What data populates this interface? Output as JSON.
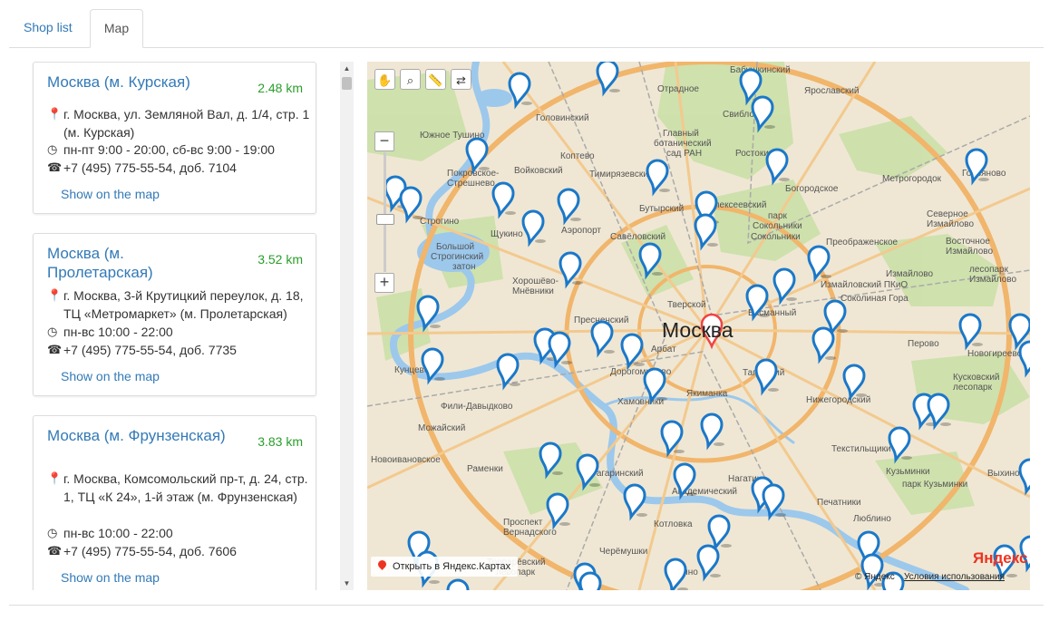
{
  "tabs": {
    "shop_list": "Shop list",
    "map": "Map"
  },
  "shops": [
    {
      "title": "Москва (м. Курская)",
      "distance": "2.48 km",
      "address": "г. Москва, ул. Земляной Вал, д. 1/4, стр. 1 (м. Курская)",
      "hours": "пн-пт 9:00 - 20:00, сб-вс 9:00 - 19:00",
      "phone": "+7 (495) 775-55-54, доб. 7104",
      "link": "Show on the map"
    },
    {
      "title": "Москва (м. Пролетарская)",
      "distance": "3.52 km",
      "address": "г. Москва, 3-й Крутицкий переулок, д. 18, ТЦ «Метромаркет» (м. Пролетарская)",
      "hours": "пн-вс 10:00 - 22:00",
      "phone": "+7 (495) 775-55-54, доб. 7735",
      "link": "Show on the map"
    },
    {
      "title": "Москва (м. Фрунзенская)",
      "distance": "3.83 km",
      "address": "г. Москва, Комсомольский пр-т, д. 24, стр. 1, ТЦ «К 24», 1-й этаж (м. Фрунзенская)",
      "hours": "пн-вс 10:00 - 22:00",
      "phone": "+7 (495) 775-55-54, доб. 7606",
      "link": "Show on the map"
    }
  ],
  "icons": {
    "address": "map-marker-icon",
    "hours": "clock-icon",
    "phone": "phone-icon"
  },
  "map": {
    "city": "Москва",
    "open_link": "Открыть в Яндекс.Картах",
    "logo": "Яндекс",
    "copyright": "© Яндекс",
    "terms": "Условия использования",
    "tools": [
      "hand-icon",
      "magnifier-icon",
      "ruler-icon",
      "route-icon"
    ],
    "districts": [
      "Бабушкинский",
      "Свиблово",
      "Ярославский",
      "Отрадное",
      "Головинский",
      "Главный ботанический сад РАН",
      "Южное Тушино",
      "Войковский",
      "Коптево",
      "Тимирязевский",
      "Покровское-Стрешнево",
      "Ростокино",
      "Метрогородок",
      "Гольяново",
      "Богородское",
      "Бутырский",
      "Алексеевский",
      "парк Сокольники",
      "Сокольники",
      "Северное Измайлово",
      "Восточное Измайлово",
      "Щукино",
      "Аэропорт",
      "Савёловский",
      "Преображенское",
      "Строгино",
      "Большой Строгинский затон",
      "Хорошёво-Мнёвники",
      "Измайловский ПКиО",
      "лесопарк Измайлово",
      "Соколиная Гора",
      "Кунцево",
      "Тверской",
      "Пресненский",
      "Арбат",
      "Басманный",
      "Перово",
      "Новогиреево",
      "Дорогомилово",
      "Хамовники",
      "Якиманка",
      "Таганский",
      "Нижегородский",
      "Кусковский лесопарк",
      "Фили-Давыдково",
      "Можайский",
      "Новоивановское",
      "Раменки",
      "Гагаринский",
      "Академический",
      "Текстильщики",
      "Кузьминки",
      "Выхино",
      "Печатники",
      "Нагатино",
      "Люблино",
      "Проспект Вернадского",
      "Котловка",
      "Черёмушки",
      "Тропарёвский лесопарк",
      "Зюзино"
    ]
  }
}
